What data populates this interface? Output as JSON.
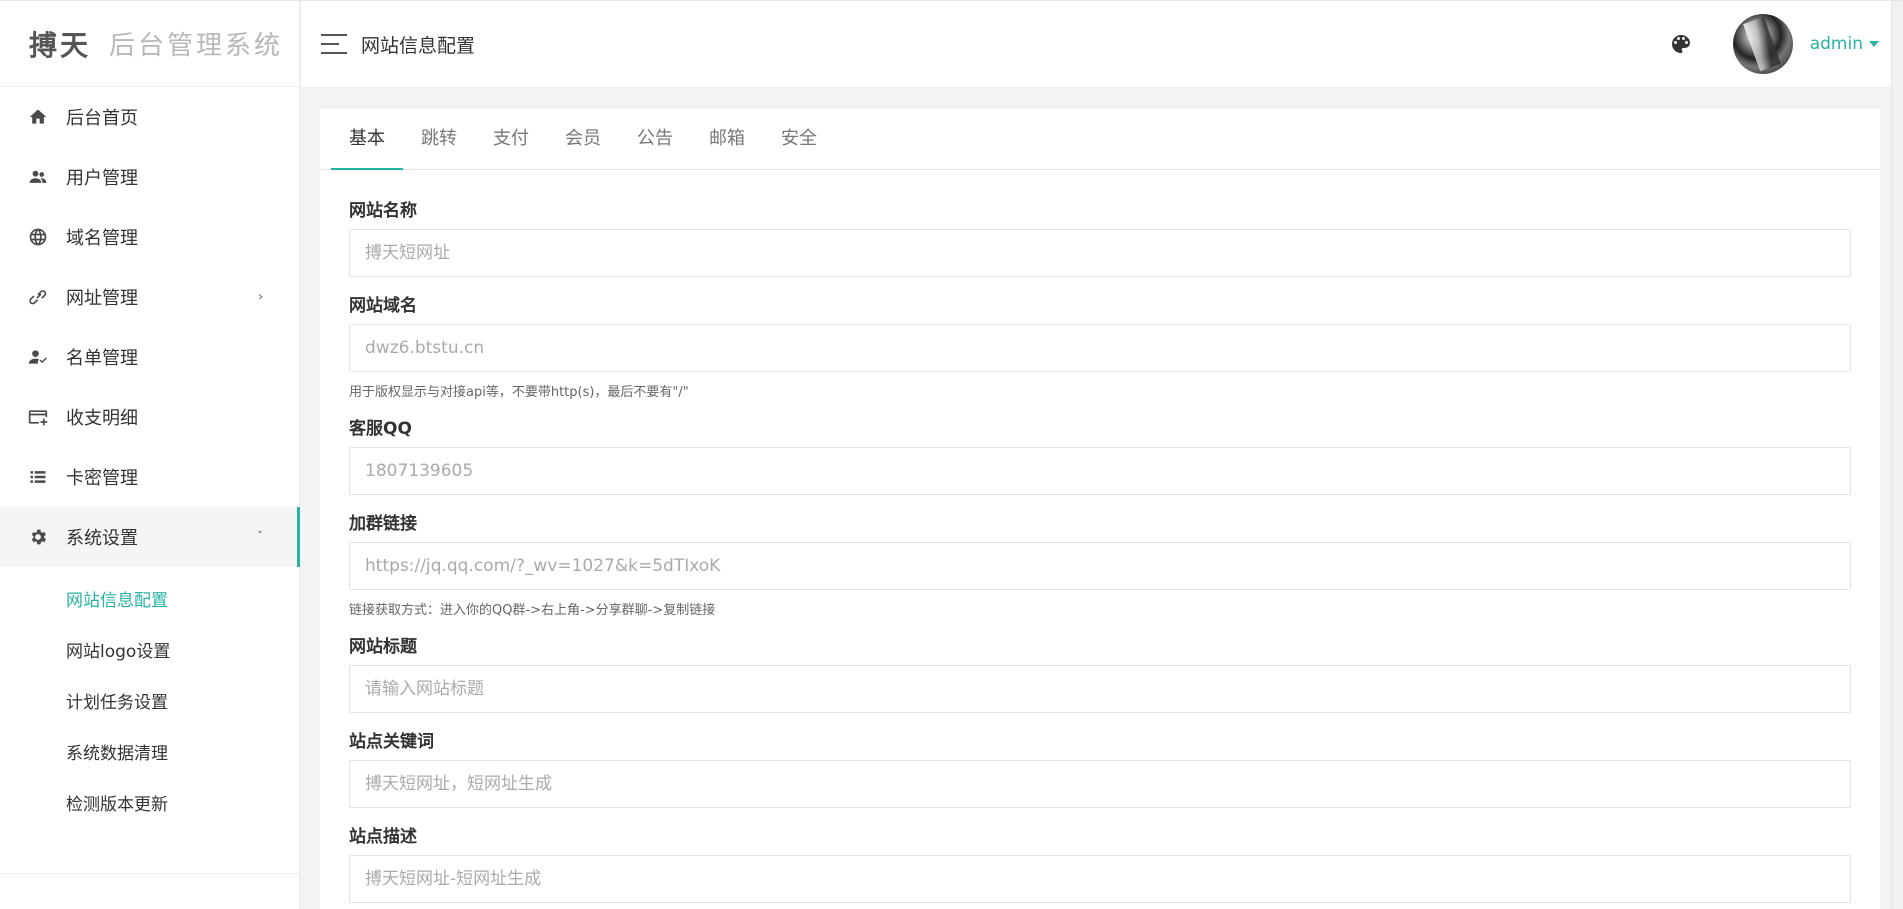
{
  "brand": {
    "logo": "搏天",
    "subtitle": "后台管理系统"
  },
  "sidebar": {
    "items": [
      {
        "label": "后台首页",
        "icon": "home-icon"
      },
      {
        "label": "用户管理",
        "icon": "users-icon"
      },
      {
        "label": "域名管理",
        "icon": "globe-icon"
      },
      {
        "label": "网址管理",
        "icon": "link-icon",
        "arrow": "›"
      },
      {
        "label": "名单管理",
        "icon": "user-check-icon"
      },
      {
        "label": "收支明细",
        "icon": "card-icon"
      },
      {
        "label": "卡密管理",
        "icon": "list-icon"
      },
      {
        "label": "系统设置",
        "icon": "gear-icon",
        "arrow": "ˇ"
      }
    ],
    "submenu": [
      {
        "label": "网站信息配置"
      },
      {
        "label": "网站logo设置"
      },
      {
        "label": "计划任务设置"
      },
      {
        "label": "系统数据清理"
      },
      {
        "label": "检测版本更新"
      }
    ]
  },
  "header": {
    "title": "网站信息配置",
    "user": "admin"
  },
  "tabs": [
    "基本",
    "跳转",
    "支付",
    "会员",
    "公告",
    "邮箱",
    "安全"
  ],
  "form": {
    "site_name": {
      "label": "网站名称",
      "value": "",
      "placeholder": "搏天短网址"
    },
    "site_domain": {
      "label": "网站域名",
      "value": "",
      "placeholder": "dwz6.btstu.cn",
      "hint": "用于版权显示与对接api等，不要带http(s)，最后不要有\"/\""
    },
    "service_qq": {
      "label": "客服QQ",
      "value": "",
      "placeholder": "1807139605"
    },
    "group_link": {
      "label": "加群链接",
      "value": "",
      "placeholder": "https://jq.qq.com/?_wv=1027&k=5dTIxoK",
      "hint": "链接获取方式：进入你的QQ群->右上角->分享群聊->复制链接"
    },
    "site_title": {
      "label": "网站标题",
      "value": "",
      "placeholder": "请输入网站标题"
    },
    "keywords": {
      "label": "站点关键词",
      "value": "",
      "placeholder": "搏天短网址，短网址生成"
    },
    "description": {
      "label": "站点描述",
      "value": "",
      "placeholder": "搏天短网址-短网址生成"
    }
  },
  "colors": {
    "accent": "#26b3a2",
    "text": "#333333",
    "muted": "#999999"
  }
}
